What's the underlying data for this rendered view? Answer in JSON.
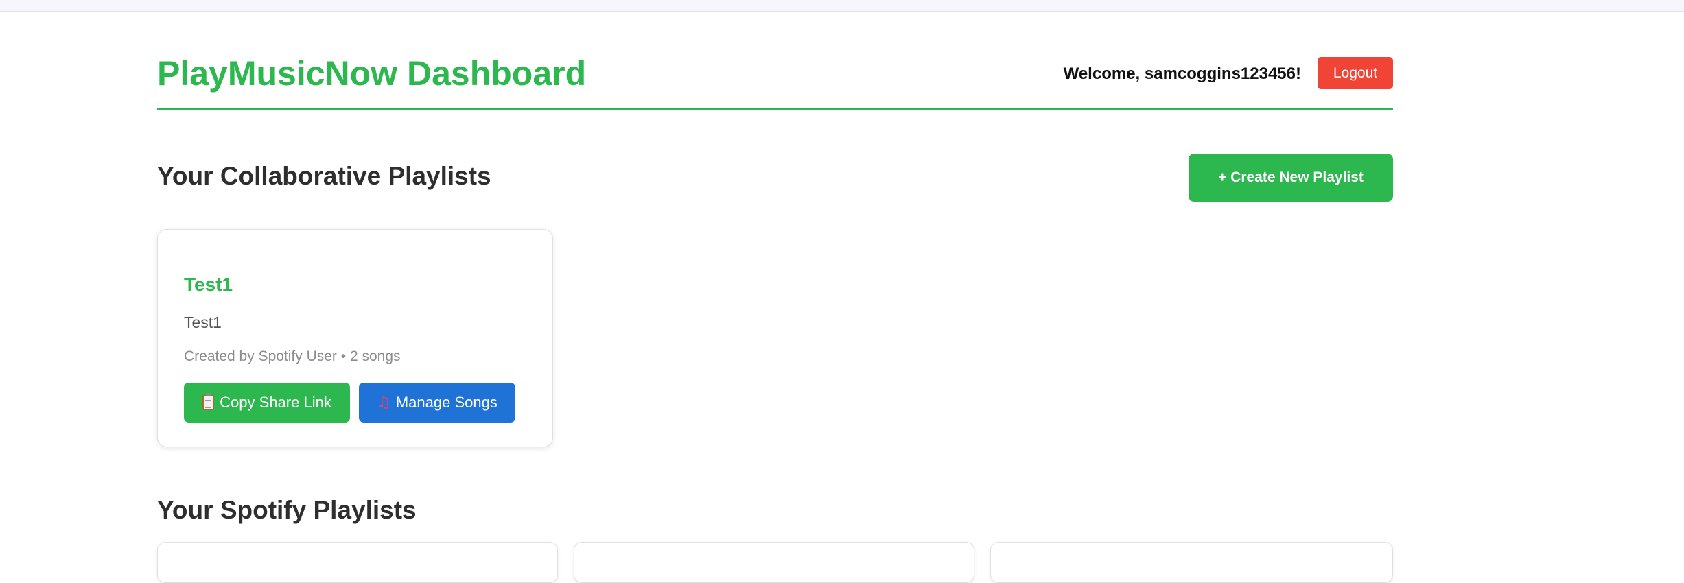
{
  "header": {
    "title": "PlayMusicNow Dashboard",
    "welcome": "Welcome, samcoggins123456!",
    "logout_label": "Logout",
    "accent_color": "#2db84f",
    "logout_color": "#f04437"
  },
  "collaborative": {
    "section_title": "Your Collaborative Playlists",
    "create_label": "+ Create New Playlist",
    "playlists": [
      {
        "name": "Test1",
        "description": "Test1",
        "meta": "Created by Spotify User • 2 songs",
        "copy_icon": "clipboard-icon",
        "copy_label": "Copy Share Link",
        "manage_icon": "music-note-icon",
        "manage_label": "Manage Songs",
        "manage_color": "#1f73d6"
      }
    ]
  },
  "spotify": {
    "section_title": "Your Spotify Playlists"
  }
}
